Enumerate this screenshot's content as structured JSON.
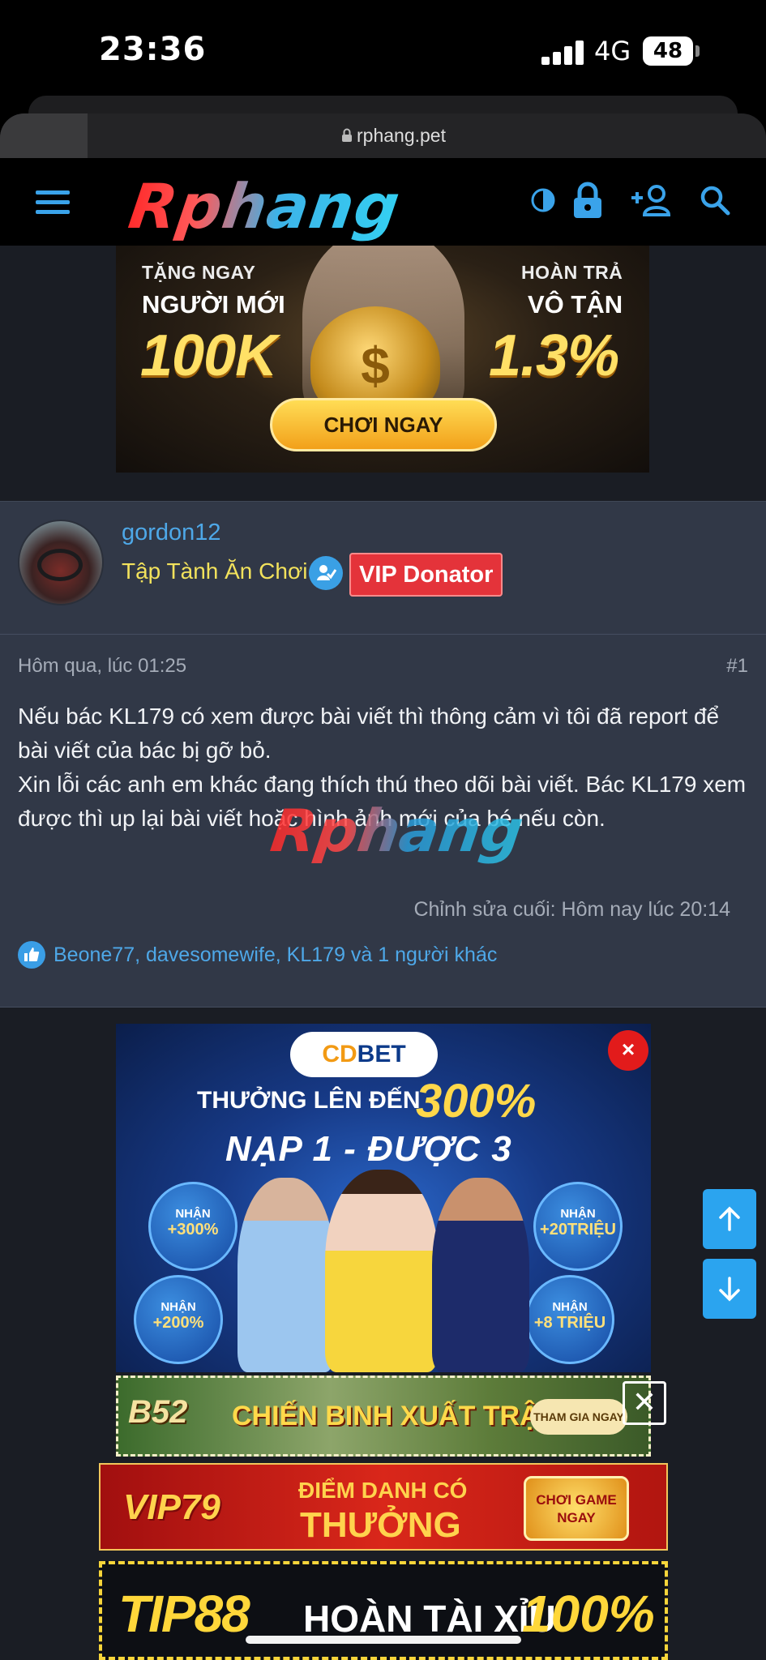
{
  "status_bar": {
    "time": "23:36",
    "network": "4G",
    "battery": "48"
  },
  "browser": {
    "url": "rphang.pet"
  },
  "site": {
    "logo_text": "Rphang"
  },
  "promo_top": {
    "left_line1": "TẶNG NGAY",
    "left_line2": "NGƯỜI MỚI",
    "left_big": "100K",
    "right_line1": "HOÀN TRẢ",
    "right_line2": "VÔ TẬN",
    "right_big": "1.3%",
    "button": "CHƠI NGAY"
  },
  "user": {
    "username": "gordon12",
    "rank": "Tập Tành Ăn Chơi",
    "badge": "VIP Donator"
  },
  "post": {
    "date": "Hôm qua, lúc 01:25",
    "number": "#1",
    "paragraph1": "Nếu bác KL179 có xem được bài viết thì thông cảm vì tôi đã report để bài viết của bác bị gỡ bỏ.",
    "paragraph2": "Xin lỗi các anh em khác đang thích thú theo dõi bài viết. Bác KL179 xem được thì up lại bài viết hoặc hình ảnh mới của bé nếu còn.",
    "watermark": "Rphang",
    "edited": "Chỉnh sửa cuối: Hôm nay lúc 20:14",
    "likes": "Beone77, davesomewife, KL179 và 1 người khác"
  },
  "ads": {
    "cdbet": {
      "brand_a": "CD",
      "brand_b": "BET",
      "close": "×",
      "line1": "THƯỞNG LÊN ĐẾN",
      "pct": "300%",
      "line2": "NẠP 1 - ĐƯỢC 3",
      "bubbles": [
        {
          "l1": "NHẬN",
          "l2": "+300%"
        },
        {
          "l1": "NHẬN",
          "l2": "+200%"
        },
        {
          "l1": "NHẬN",
          "l2": "+20TRIỆU"
        },
        {
          "l1": "NHẬN",
          "l2": "+8 TRIỆU"
        }
      ]
    },
    "b52": {
      "logo": "B52",
      "text": "CHIẾN BINH XUẤT TRẬN",
      "button": "THAM GIA NGAY",
      "close": "✕"
    },
    "vip79": {
      "logo": "VIP79",
      "line1": "ĐIỂM DANH CÓ",
      "line2": "THƯỞNG",
      "button": "CHƠI GAME NGAY"
    },
    "tip88": {
      "logo": "TIP88",
      "text": "HOÀN TÀI XỈU",
      "pct": "100%"
    }
  },
  "colors": {
    "accent": "#3aa3ea",
    "panel": "#313847",
    "rank": "#f2e25c",
    "vip": "#e4333a"
  }
}
